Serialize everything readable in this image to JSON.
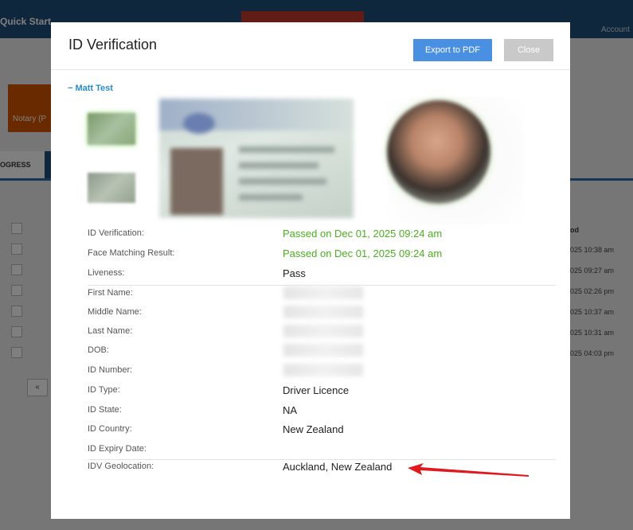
{
  "background": {
    "quick_start": "Quick Start",
    "account": "Account",
    "notary_tile": "Notary (P",
    "tab_progress": "OGRESS",
    "table_head": "od",
    "times": [
      "025 10:38 am",
      "025 09:27 am",
      "025 02:26 pm",
      "025 10:37 am",
      "025 10:31 am",
      "025 04:03 pm"
    ],
    "pagination_prev": "«"
  },
  "modal": {
    "title": "ID Verification",
    "export_label": "Export to PDF",
    "close_label": "Close",
    "person_name": "− Matt Test"
  },
  "fields": [
    {
      "label": "ID Verification:",
      "value": "Passed on Dec 01, 2025 09:24 am",
      "status": "pass"
    },
    {
      "label": "Face Matching Result:",
      "value": "Passed on Dec 01, 2025 09:24 am",
      "status": "pass"
    },
    {
      "label": "Liveness:",
      "value": "Pass",
      "status": "normal"
    },
    {
      "label": "First Name:",
      "value": "",
      "status": "redacted"
    },
    {
      "label": "Middle Name:",
      "value": "",
      "status": "redacted"
    },
    {
      "label": "Last Name:",
      "value": "",
      "status": "redacted"
    },
    {
      "label": "DOB:",
      "value": "",
      "status": "redacted"
    },
    {
      "label": "ID Number:",
      "value": "",
      "status": "redacted"
    },
    {
      "label": "ID Type:",
      "value": "Driver Licence",
      "status": "normal"
    },
    {
      "label": "ID State:",
      "value": "NA",
      "status": "normal"
    },
    {
      "label": "ID Country:",
      "value": "New Zealand",
      "status": "normal"
    },
    {
      "label": "ID Expiry Date:",
      "value": "",
      "status": "normal"
    },
    {
      "label": "IDV Geolocation:",
      "value": "Auckland, New Zealand",
      "status": "normal"
    }
  ],
  "colors": {
    "pass_green": "#4cae1e",
    "primary_button": "#4a90e2",
    "annotation_arrow": "#e0191f"
  }
}
